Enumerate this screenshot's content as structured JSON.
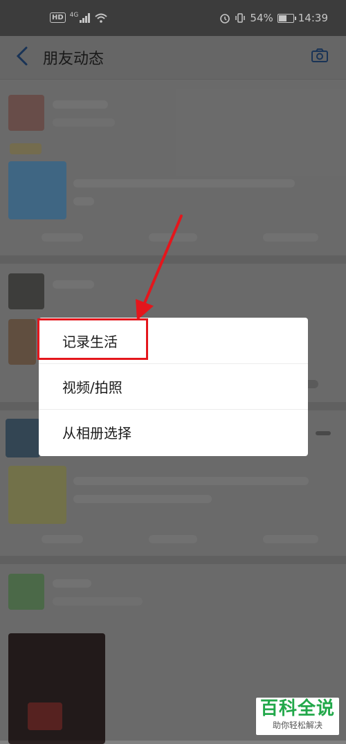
{
  "status_bar": {
    "network": "4G",
    "hd_badge": "HD",
    "battery": "54%",
    "battery_fraction": 0.54,
    "time": "14:39"
  },
  "nav": {
    "title": "朋友动态",
    "back_icon": "chevron-left-icon",
    "camera_icon": "camera-icon"
  },
  "menu": {
    "items": [
      {
        "label": "记录生活"
      },
      {
        "label": "视频/拍照"
      },
      {
        "label": "从相册选择"
      }
    ],
    "highlight_color": "#e4161c"
  },
  "watermark": {
    "title": "百科全说",
    "subtitle": "助你轻松解决"
  },
  "colors": {
    "dim_background": "#808080",
    "menu_background": "#ffffff",
    "watermark_green": "#22a84a"
  }
}
